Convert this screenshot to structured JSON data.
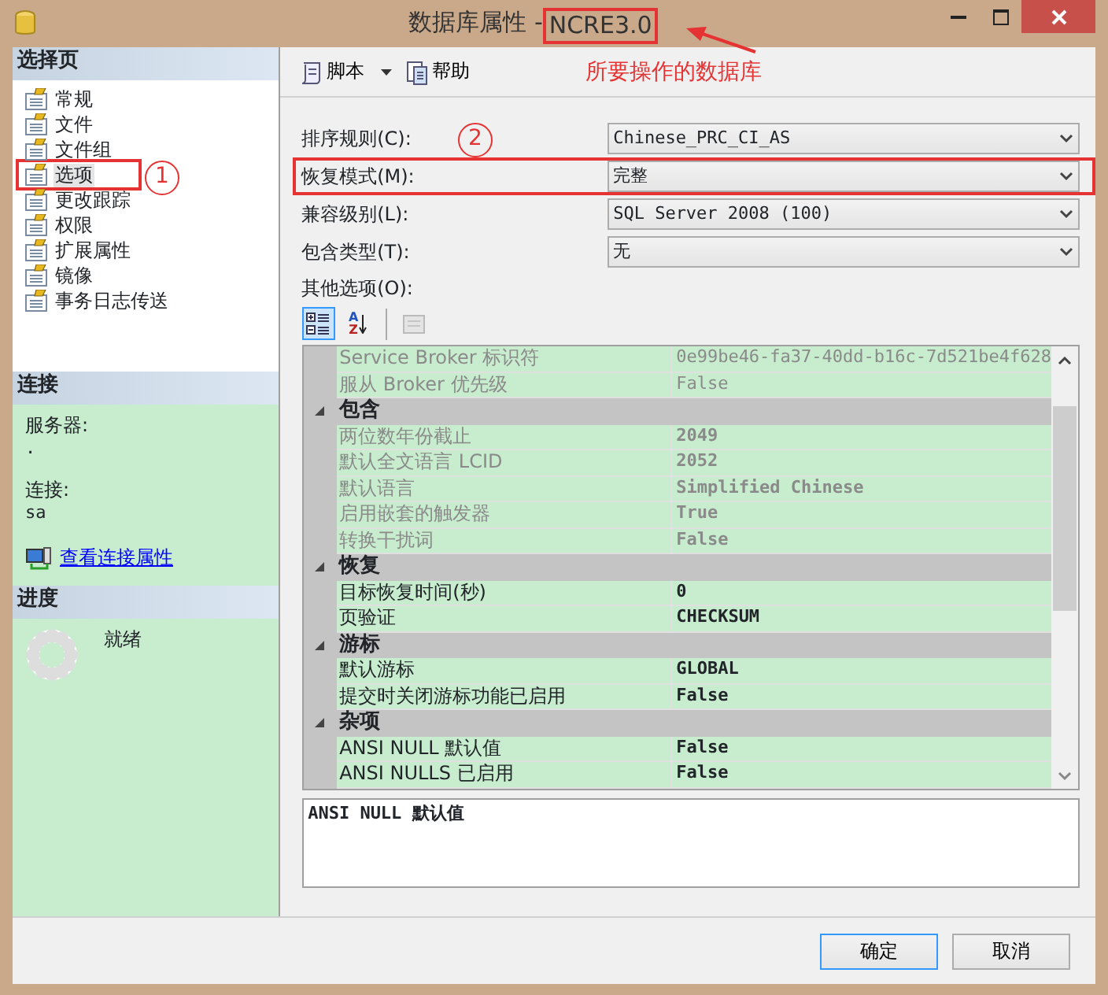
{
  "window": {
    "title_prefix": "数据库属性 - ",
    "title_db": "NCRE3.0",
    "title_db_highlighted": true
  },
  "sidebar": {
    "header": "选择页",
    "items": [
      {
        "label": "常规",
        "selected": false,
        "highlighted": false
      },
      {
        "label": "文件",
        "selected": false,
        "highlighted": false
      },
      {
        "label": "文件组",
        "selected": false,
        "highlighted": false
      },
      {
        "label": "选项",
        "selected": true,
        "highlighted": true
      },
      {
        "label": "更改跟踪",
        "selected": false,
        "highlighted": false
      },
      {
        "label": "权限",
        "selected": false,
        "highlighted": false
      },
      {
        "label": "扩展属性",
        "selected": false,
        "highlighted": false
      },
      {
        "label": "镜像",
        "selected": false,
        "highlighted": false
      },
      {
        "label": "事务日志传送",
        "selected": false,
        "highlighted": false
      }
    ]
  },
  "connection": {
    "header": "连接",
    "server_label": "服务器:",
    "server_value": ".",
    "login_label": "连接:",
    "login_value": "sa",
    "link": "查看连接属性"
  },
  "progress": {
    "header": "进度",
    "status": "就绪"
  },
  "toolbar": [
    {
      "kind": "dropdown",
      "label": "脚本"
    },
    {
      "kind": "button",
      "label": "帮助"
    }
  ],
  "annotations": [
    {
      "kind": "note",
      "text": "所要操作的数据库"
    },
    {
      "kind": "marker",
      "text": "1"
    },
    {
      "kind": "marker",
      "text": "2"
    }
  ],
  "fields": [
    {
      "label": "排序规则(C):",
      "value": "Chinese_PRC_CI_AS",
      "highlighted": false
    },
    {
      "label": "恢复模式(M):",
      "value": "完整",
      "highlighted": true
    },
    {
      "label": "兼容级别(L):",
      "value": "SQL Server 2008 (100)",
      "highlighted": false
    },
    {
      "label": "包含类型(T):",
      "value": "无",
      "highlighted": false
    }
  ],
  "other_options_label": "其他选项(O):",
  "grid": {
    "view_buttons": [
      {
        "kind": "categorized",
        "selected": true,
        "disabled": false
      },
      {
        "kind": "alphabetical",
        "selected": false,
        "disabled": false,
        "letters": [
          "A",
          "Z"
        ]
      },
      {
        "kind": "pages",
        "selected": false,
        "disabled": true
      }
    ],
    "rows": [
      {
        "kind": "property",
        "name": "Service Broker 标识符",
        "value": "0e99be46-fa37-40dd-b16c-7d521be4f628",
        "readonly": true,
        "bold": false
      },
      {
        "kind": "property",
        "name": "服从 Broker 优先级",
        "value": "False",
        "readonly": true,
        "bold": false
      },
      {
        "kind": "category",
        "name": "包含",
        "expanded": true
      },
      {
        "kind": "property",
        "name": "两位数年份截止",
        "value": "2049",
        "readonly": true,
        "bold": true
      },
      {
        "kind": "property",
        "name": "默认全文语言 LCID",
        "value": "2052",
        "readonly": true,
        "bold": true
      },
      {
        "kind": "property",
        "name": "默认语言",
        "value": "Simplified Chinese",
        "readonly": true,
        "bold": true
      },
      {
        "kind": "property",
        "name": "启用嵌套的触发器",
        "value": "True",
        "readonly": true,
        "bold": true
      },
      {
        "kind": "property",
        "name": "转换干扰词",
        "value": "False",
        "readonly": true,
        "bold": true
      },
      {
        "kind": "category",
        "name": "恢复",
        "expanded": true
      },
      {
        "kind": "property",
        "name": "目标恢复时间(秒)",
        "value": "0",
        "readonly": false,
        "bold": true
      },
      {
        "kind": "property",
        "name": "页验证",
        "value": "CHECKSUM",
        "readonly": false,
        "bold": true
      },
      {
        "kind": "category",
        "name": "游标",
        "expanded": true
      },
      {
        "kind": "property",
        "name": "默认游标",
        "value": "GLOBAL",
        "readonly": false,
        "bold": true
      },
      {
        "kind": "property",
        "name": "提交时关闭游标功能已启用",
        "value": "False",
        "readonly": false,
        "bold": true
      },
      {
        "kind": "category",
        "name": "杂项",
        "expanded": true
      },
      {
        "kind": "property",
        "name": "ANSI NULL 默认值",
        "value": "False",
        "readonly": false,
        "bold": true
      },
      {
        "kind": "property",
        "name": "ANSI NULLS 已启用",
        "value": "False",
        "readonly": false,
        "bold": true
      }
    ]
  },
  "description": "ANSI NULL 默认值",
  "buttons": [
    {
      "label": "确定",
      "default": true
    },
    {
      "label": "取消",
      "default": false
    }
  ]
}
